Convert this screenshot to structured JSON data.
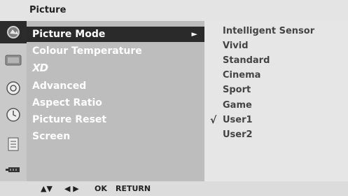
{
  "header": {
    "title": "Picture"
  },
  "menu": {
    "items": [
      {
        "label": "Picture Mode",
        "selected": true,
        "has_submenu": true
      },
      {
        "label": "Colour Temperature"
      },
      {
        "label": "XD"
      },
      {
        "label": "Advanced"
      },
      {
        "label": "Aspect Ratio"
      },
      {
        "label": "Picture Reset"
      },
      {
        "label": "Screen"
      }
    ],
    "submenu_arrow": "►"
  },
  "submenu": {
    "items": [
      {
        "label": "Intelligent Sensor"
      },
      {
        "label": "Vivid"
      },
      {
        "label": "Standard"
      },
      {
        "label": "Cinema"
      },
      {
        "label": "Sport"
      },
      {
        "label": "Game"
      },
      {
        "label": "User1",
        "checked": true
      },
      {
        "label": "User2"
      }
    ],
    "check_mark": "√"
  },
  "sidebar_icons": [
    "picture-mode-icon",
    "monitor-icon",
    "audio-icon",
    "clock-icon",
    "option-icon",
    "input-icon"
  ],
  "footer": {
    "nav_updown": "▲▼",
    "nav_leftright": "◀ ▶",
    "ok": "OK",
    "return": "RETURN"
  }
}
